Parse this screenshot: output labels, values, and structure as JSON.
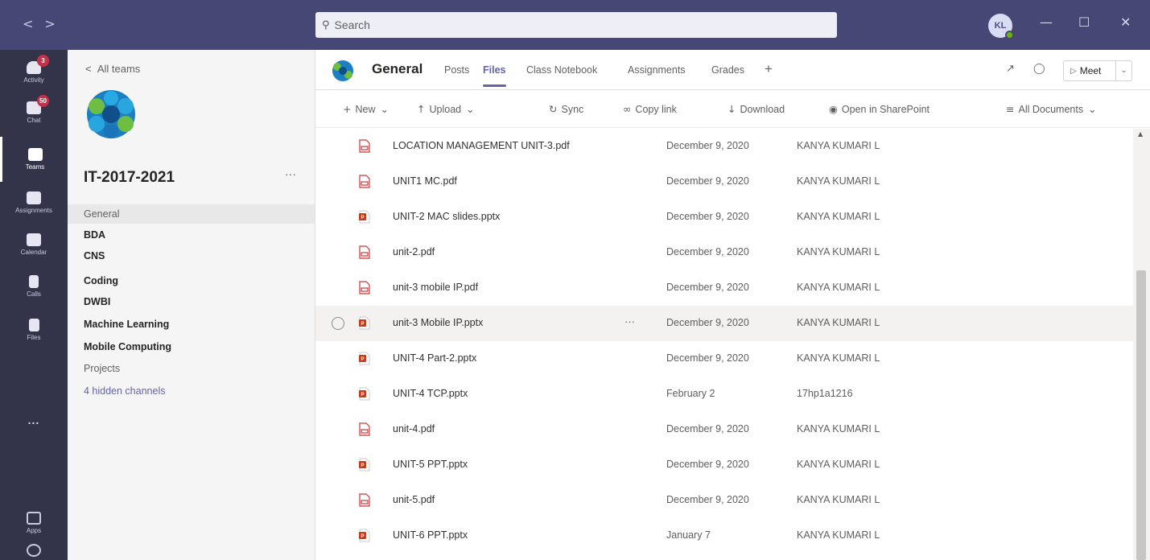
{
  "titlebar": {
    "search_placeholder": "Search",
    "avatar_initials": "KL"
  },
  "rail": {
    "items": [
      {
        "label": "Activity",
        "badge": "3",
        "icon": "bell-icon"
      },
      {
        "label": "Chat",
        "badge": "50",
        "icon": "chat-icon"
      },
      {
        "label": "Teams",
        "badge": "",
        "icon": "teams-icon"
      },
      {
        "label": "Assignments",
        "badge": "",
        "icon": "assignments-icon"
      },
      {
        "label": "Calendar",
        "badge": "",
        "icon": "calendar-icon"
      },
      {
        "label": "Calls",
        "badge": "",
        "icon": "phone-icon"
      },
      {
        "label": "Files",
        "badge": "",
        "icon": "file-icon"
      }
    ],
    "more": "...",
    "apps_label": "Apps"
  },
  "channels": {
    "back_label": "All teams",
    "team_name": "IT-2017-2021",
    "team_more": "···",
    "items": [
      {
        "label": "General",
        "style": "sel"
      },
      {
        "label": "BDA",
        "style": "bold"
      },
      {
        "label": "CNS",
        "style": "bold"
      },
      {
        "label": "Coding",
        "style": "bold"
      },
      {
        "label": "DWBI",
        "style": "bold"
      },
      {
        "label": "Machine Learning",
        "style": "bold"
      },
      {
        "label": "Mobile Computing",
        "style": "bold"
      },
      {
        "label": "Projects",
        "style": "light"
      },
      {
        "label": "4 hidden channels",
        "style": "link"
      }
    ]
  },
  "header": {
    "channel_title": "General",
    "tabs": [
      "Posts",
      "Files",
      "Class Notebook",
      "Assignments",
      "Grades"
    ],
    "active_tab": "Files",
    "add_tab": "+",
    "meet_label": "Meet"
  },
  "commands": {
    "new": "New",
    "upload": "Upload",
    "sync": "Sync",
    "copy_link": "Copy link",
    "download": "Download",
    "open_sharepoint": "Open in SharePoint",
    "view": "All Documents"
  },
  "files": [
    {
      "name": "LOCATION MANAGEMENT UNIT-3.pdf",
      "date": "December 9, 2020",
      "by": "KANYA KUMARI L",
      "type": "pdf"
    },
    {
      "name": "UNIT1 MC.pdf",
      "date": "December 9, 2020",
      "by": "KANYA KUMARI L",
      "type": "pdf"
    },
    {
      "name": "UNIT-2 MAC slides.pptx",
      "date": "December 9, 2020",
      "by": "KANYA KUMARI L",
      "type": "pptx"
    },
    {
      "name": "unit-2.pdf",
      "date": "December 9, 2020",
      "by": "KANYA KUMARI L",
      "type": "pdf"
    },
    {
      "name": "unit-3 mobile IP.pdf",
      "date": "December 9, 2020",
      "by": "KANYA KUMARI L",
      "type": "pdf"
    },
    {
      "name": "unit-3 Mobile IP.pptx",
      "date": "December 9, 2020",
      "by": "KANYA KUMARI L",
      "type": "pptx"
    },
    {
      "name": "UNIT-4 Part-2.pptx",
      "date": "December 9, 2020",
      "by": "KANYA KUMARI L",
      "type": "pptx"
    },
    {
      "name": "UNIT-4 TCP.pptx",
      "date": "February 2",
      "by": "17hp1a1216",
      "type": "pptx"
    },
    {
      "name": "unit-4.pdf",
      "date": "December 9, 2020",
      "by": "KANYA KUMARI L",
      "type": "pdf"
    },
    {
      "name": "UNIT-5 PPT.pptx",
      "date": "December 9, 2020",
      "by": "KANYA KUMARI L",
      "type": "pptx"
    },
    {
      "name": "unit-5.pdf",
      "date": "December 9, 2020",
      "by": "KANYA KUMARI L",
      "type": "pdf"
    },
    {
      "name": "UNIT-6 PPT.pptx",
      "date": "January 7",
      "by": "KANYA KUMARI L",
      "type": "pptx"
    }
  ],
  "hover_row_more": "···",
  "colors": {
    "titlebar": "#464775",
    "rail": "#33344a",
    "accent": "#6264a7",
    "pdf": "#d13438",
    "pptx": "#c43e1c"
  }
}
